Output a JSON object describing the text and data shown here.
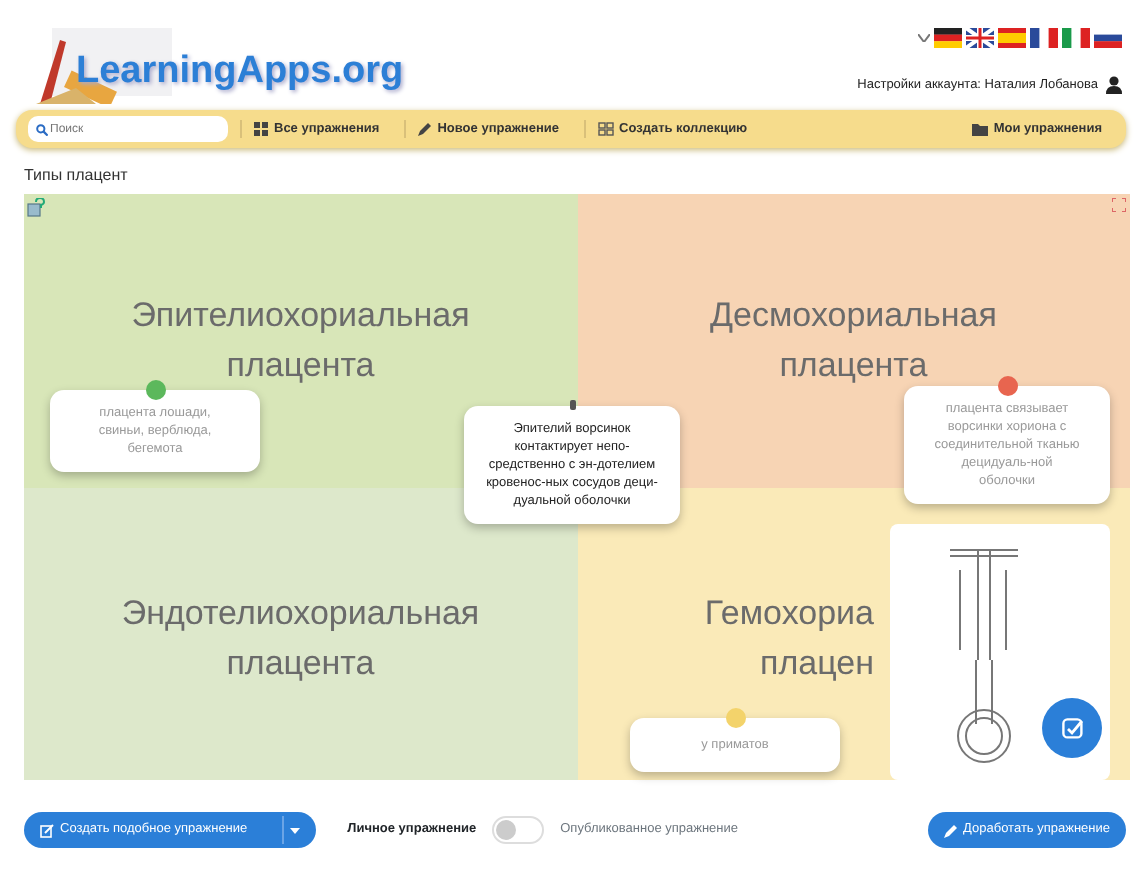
{
  "header": {
    "logo": "LearningApps.org",
    "account": "Настройки аккаунта: Наталия Лобанова"
  },
  "nav": {
    "search": {
      "placeholder": "Поиск"
    },
    "items": [
      {
        "label": "Все упражнения"
      },
      {
        "label": "Новое упражнение"
      },
      {
        "label": "Создать коллекцию"
      }
    ],
    "right_item": {
      "label": "Мои упражнения"
    }
  },
  "page_title": "Типы плацент",
  "board": {
    "quadrants": [
      {
        "color": "#d8e6b8",
        "lines": [
          "Эпителиохориальная",
          "плацента"
        ]
      },
      {
        "color": "#f7d4b4",
        "lines": [
          "Десмохориальная",
          "плацента"
        ]
      },
      {
        "color": "#dde8cb",
        "lines": [
          "Эндотелиохориальная",
          "плацента"
        ]
      },
      {
        "color": "#faeab8",
        "lines": [
          "Гемохориа",
          "плацен"
        ]
      }
    ],
    "cards": [
      {
        "kind": "dot",
        "color": "#5cb85c",
        "text": "плацента лошади, свиньи, верблюда, бегемота"
      },
      {
        "kind": "pin",
        "text": "Эпителий ворсинок контактирует непо-средственно с эн-дотелием кровенос-ных сосудов деци-дуальной оболочки"
      },
      {
        "kind": "dot",
        "color": "#e8654f",
        "text": "плацента связывает ворсинки хориона с соединительной тканью децидуаль-ной оболочки"
      },
      {
        "kind": "dot",
        "color": "#f3d36b",
        "text": "у приматов"
      }
    ]
  },
  "footer": {
    "create_button": "Создать подобное упражнение",
    "private_label": "Личное упражнение",
    "published": false,
    "public_label": "Опубликованное упражнение",
    "improve_button": "Доработать упражнение"
  }
}
